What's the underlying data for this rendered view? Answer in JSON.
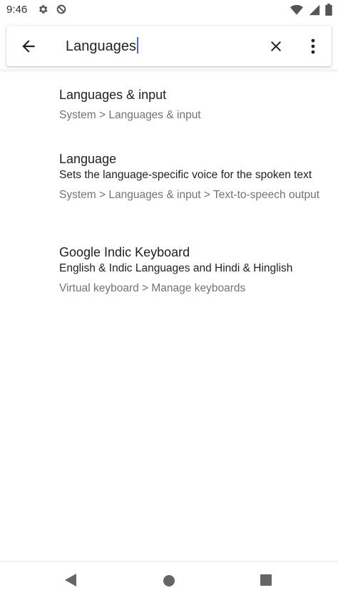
{
  "status_bar": {
    "time": "9:46",
    "icons_left": [
      "settings-gear-icon",
      "data-saver-icon"
    ],
    "icons_right": [
      "wifi-icon",
      "cell-signal-icon",
      "battery-icon"
    ]
  },
  "search": {
    "query": "Languages",
    "back_icon": "arrow-back-icon",
    "clear_icon": "close-icon",
    "more_icon": "more-vert-icon"
  },
  "results": [
    {
      "title": "Languages & input",
      "summary": "",
      "path": "System > Languages & input"
    },
    {
      "title": "Language",
      "summary": "Sets the language-specific voice for the spoken text",
      "path": "System > Languages & input > Text-to-speech output"
    },
    {
      "title": "Google Indic Keyboard",
      "summary": "English & Indic Languages and Hindi & Hinglish",
      "path": "Virtual keyboard > Manage keyboards"
    }
  ],
  "nav_bar": {
    "icons": [
      "nav-back-icon",
      "nav-home-icon",
      "nav-recents-icon"
    ]
  },
  "colors": {
    "accent_caret": "#2f6fe4",
    "title_text": "#212121",
    "secondary_text": "#737373"
  }
}
